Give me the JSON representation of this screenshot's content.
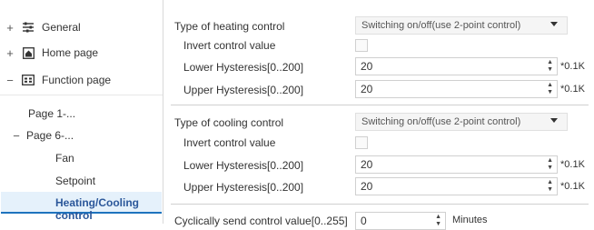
{
  "sidebar": {
    "items": [
      {
        "expander": "+",
        "label": "General",
        "icon": "sliders-icon"
      },
      {
        "expander": "+",
        "label": "Home page",
        "icon": "home-icon"
      },
      {
        "expander": "−",
        "label": "Function page",
        "icon": "grid-icon"
      }
    ],
    "sub_items": [
      {
        "label": "Page 1-..."
      },
      {
        "expander": "−",
        "label": "Page 6-..."
      },
      {
        "label": "Fan"
      },
      {
        "label": "Setpoint"
      },
      {
        "label": "Heating/Cooling control",
        "active": true
      }
    ]
  },
  "heating": {
    "type_label": "Type of heating control",
    "type_value": "Switching on/off(use 2-point control)",
    "invert_label": "Invert control value",
    "lower_label": "Lower Hysteresis[0..200]",
    "lower_value": "20",
    "lower_unit": "*0.1K",
    "upper_label": "Upper Hysteresis[0..200]",
    "upper_value": "20",
    "upper_unit": "*0.1K"
  },
  "cooling": {
    "type_label": "Type of cooling control",
    "type_value": "Switching on/off(use 2-point control)",
    "invert_label": "Invert control value",
    "lower_label": "Lower Hysteresis[0..200]",
    "lower_value": "20",
    "lower_unit": "*0.1K",
    "upper_label": "Upper Hysteresis[0..200]",
    "upper_value": "20",
    "upper_unit": "*0.1K"
  },
  "cyclic": {
    "label": "Cyclically send control value[0..255]",
    "value": "0",
    "unit": "Minutes"
  },
  "colors": {
    "active_bg": "#e5f1fb",
    "active_text": "#2b579a",
    "accent": "#1e73be"
  }
}
